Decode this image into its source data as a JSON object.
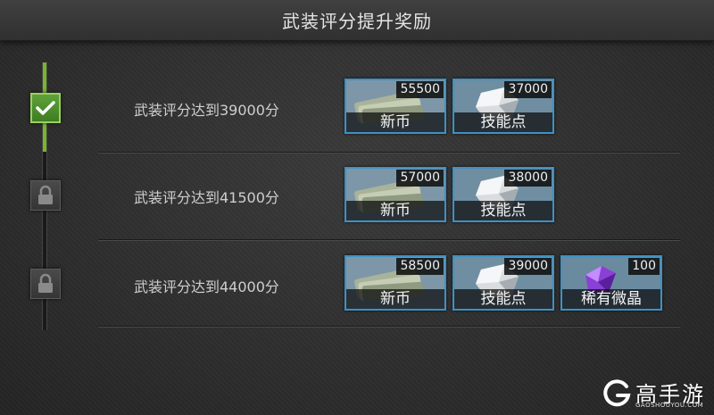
{
  "header": {
    "title": "武装评分提升奖励"
  },
  "tiers": [
    {
      "status": "claimed",
      "label": "武装评分达到39000分",
      "rewards": [
        {
          "name": "新币",
          "count": "55500",
          "icon": "cash-stack-icon"
        },
        {
          "name": "技能点",
          "count": "37000",
          "icon": "skill-crystal-icon"
        }
      ]
    },
    {
      "status": "locked",
      "label": "武装评分达到41500分",
      "rewards": [
        {
          "name": "新币",
          "count": "57000",
          "icon": "cash-stack-icon"
        },
        {
          "name": "技能点",
          "count": "38000",
          "icon": "skill-crystal-icon"
        }
      ]
    },
    {
      "status": "locked",
      "label": "武装评分达到44000分",
      "rewards": [
        {
          "name": "新币",
          "count": "58500",
          "icon": "cash-stack-icon"
        },
        {
          "name": "技能点",
          "count": "39000",
          "icon": "skill-crystal-icon"
        },
        {
          "name": "稀有微晶",
          "count": "100",
          "icon": "purple-gem-icon"
        }
      ]
    }
  ],
  "colors": {
    "accent_green": "#7ab52e",
    "reward_border": "#3e91c4",
    "gem_purple": "#8a3fd6"
  },
  "watermark": {
    "name": "高手游",
    "site": "GAOSHOUYOU.COM"
  }
}
